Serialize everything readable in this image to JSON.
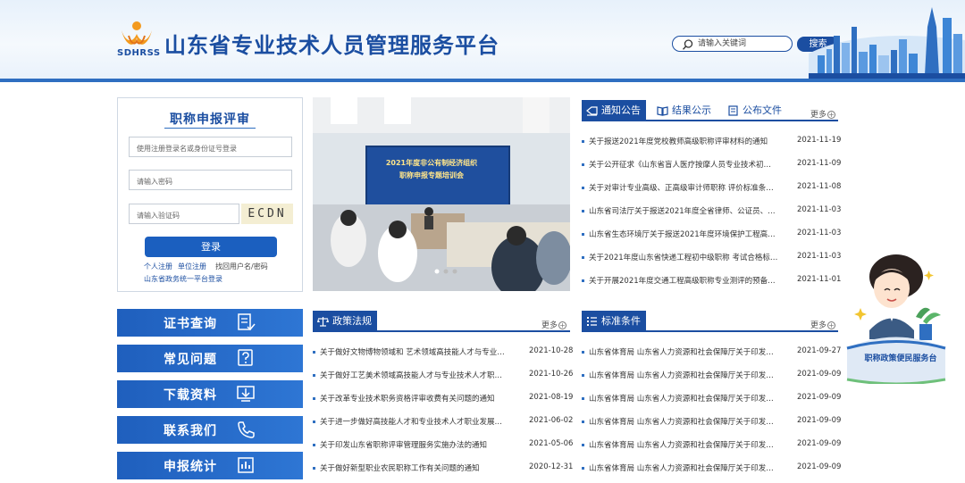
{
  "header": {
    "logo_text": "SDHRSS",
    "site_title": "山东省专业技术人员管理服务平台",
    "search_placeholder": "请输入关键词",
    "search_button": "搜索"
  },
  "login": {
    "title": "职称申报评审",
    "username_placeholder": "使用注册登录名或身份证号登录",
    "password_placeholder": "请输入密码",
    "captcha_placeholder": "请输入验证码",
    "captcha_text": "ECDN",
    "login_button": "登录",
    "link_personal": "个人注册",
    "link_unit": "单位注册",
    "link_recover": "找回用户名/密码",
    "link_gov": "山东省政务统一平台登录"
  },
  "side_nav": [
    {
      "label": "证书查询",
      "icon": "certificate-icon"
    },
    {
      "label": "常见问题",
      "icon": "question-icon"
    },
    {
      "label": "下载资料",
      "icon": "download-icon"
    },
    {
      "label": "联系我们",
      "icon": "phone-icon"
    },
    {
      "label": "申报统计",
      "icon": "chart-icon"
    }
  ],
  "photo": {
    "caption_line1": "2021年度非公有制经济组织",
    "caption_line2": "职称申报专题培训会"
  },
  "notice": {
    "tabs": [
      "通知公告",
      "结果公示",
      "公布文件"
    ],
    "more": "更多",
    "items": [
      {
        "title": "关于报送2021年度党校教师高级职称评审材料的通知",
        "date": "2021-11-19"
      },
      {
        "title": "关于公开征求《山东省盲人医疗按摩人员专业技术初…",
        "date": "2021-11-09"
      },
      {
        "title": "关于对审计专业高级、正高级审计师职称 评价标准条…",
        "date": "2021-11-08"
      },
      {
        "title": "山东省司法厅关于报送2021年度全省律师、公证员、…",
        "date": "2021-11-03"
      },
      {
        "title": "山东省生态环境厅关于报送2021年度环境保护工程高…",
        "date": "2021-11-03"
      },
      {
        "title": "关于2021年度山东省快递工程初中级职称 考试合格标…",
        "date": "2021-11-03"
      },
      {
        "title": "关于开展2021年度交通工程高级职称专业测评的预备…",
        "date": "2021-11-01"
      }
    ]
  },
  "policy": {
    "tab": "政策法规",
    "more": "更多",
    "items": [
      {
        "title": "关于做好文物博物领域和 艺术领域高技能人才与专业…",
        "date": "2021-10-28"
      },
      {
        "title": "关于做好工艺美术领域高技能人才与专业技术人才职…",
        "date": "2021-10-26"
      },
      {
        "title": "关于改革专业技术职务资格评审收费有关问题的通知",
        "date": "2021-08-19"
      },
      {
        "title": "关于进一步做好高技能人才和专业技术人才职业发展…",
        "date": "2021-06-02"
      },
      {
        "title": "关于印发山东省职称评审管理服务实施办法的通知",
        "date": "2021-05-06"
      },
      {
        "title": "关于做好新型职业农民职称工作有关问题的通知",
        "date": "2020-12-31"
      }
    ]
  },
  "standard": {
    "tab": "标准条件",
    "more": "更多",
    "items": [
      {
        "title": "山东省体育局 山东省人力资源和社会保障厅关于印发…",
        "date": "2021-09-27"
      },
      {
        "title": "山东省体育局 山东省人力资源和社会保障厅关于印发…",
        "date": "2021-09-09"
      },
      {
        "title": "山东省体育局 山东省人力资源和社会保障厅关于印发…",
        "date": "2021-09-09"
      },
      {
        "title": "山东省体育局 山东省人力资源和社会保障厅关于印发…",
        "date": "2021-09-09"
      },
      {
        "title": "山东省体育局 山东省人力资源和社会保障厅关于印发…",
        "date": "2021-09-09"
      },
      {
        "title": "山东省体育局 山东省人力资源和社会保障厅关于印发…",
        "date": "2021-09-09"
      }
    ]
  },
  "mascot": {
    "label": "职称政策便民服务台"
  },
  "colors": {
    "brand": "#1b4ea1",
    "accent": "#2f6fc1"
  }
}
